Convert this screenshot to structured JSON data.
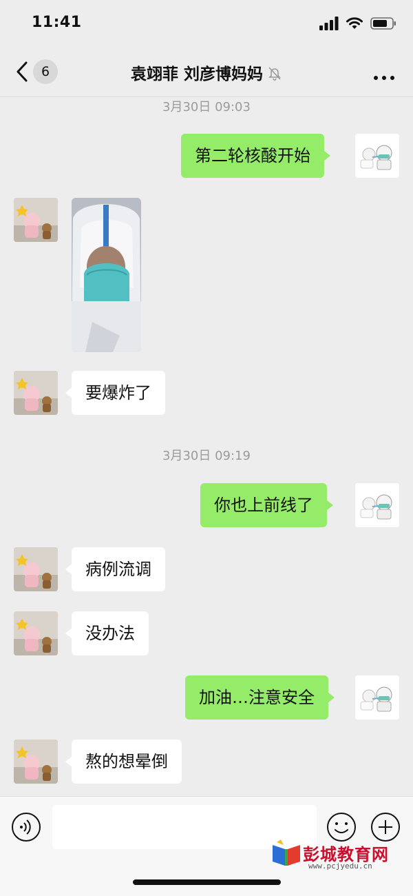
{
  "status_bar": {
    "time": "11:41"
  },
  "header": {
    "unread_count": "6",
    "chat_title": "袁翊菲 刘彦博妈妈",
    "muted_icon": "bell-slash-icon",
    "more_icon": "ellipsis-icon"
  },
  "messages": [
    {
      "type": "timestamp",
      "text": "3月30日 09:03"
    },
    {
      "type": "text",
      "sender": "me",
      "text": "第二轮核酸开始"
    },
    {
      "type": "image",
      "sender": "other",
      "description_icon": "photo-protective-suit"
    },
    {
      "type": "text",
      "sender": "other",
      "text": "要爆炸了"
    },
    {
      "type": "timestamp",
      "text": "3月30日 09:19"
    },
    {
      "type": "text",
      "sender": "me",
      "text": "你也上前线了"
    },
    {
      "type": "text",
      "sender": "other",
      "text": "病例流调"
    },
    {
      "type": "text",
      "sender": "other",
      "text": "没办法"
    },
    {
      "type": "text",
      "sender": "me",
      "text": "加油…注意安全"
    },
    {
      "type": "text",
      "sender": "other",
      "text": "熬的想晕倒"
    }
  ],
  "input_bar": {
    "voice_icon": "voice-icon",
    "emoji_icon": "emoji-icon",
    "plus_icon": "plus-icon",
    "input_value": ""
  },
  "watermark": {
    "text": "彭城教育网",
    "url": "www.pcjyedu.cn"
  },
  "colors": {
    "sent_bubble": "#95ec69",
    "received_bubble": "#ffffff",
    "background": "#ededed",
    "watermark": "#c8102e"
  }
}
